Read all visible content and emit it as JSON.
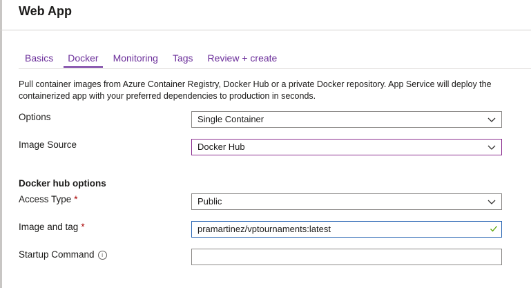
{
  "header": {
    "title": "Web App"
  },
  "tabs": [
    {
      "label": "Basics",
      "active": false
    },
    {
      "label": "Docker",
      "active": true
    },
    {
      "label": "Monitoring",
      "active": false
    },
    {
      "label": "Tags",
      "active": false
    },
    {
      "label": "Review + create",
      "active": false
    }
  ],
  "intro": {
    "text": "Pull container images from Azure Container Registry, Docker Hub or a private Docker repository. App Service will deploy the containerized app with your preferred dependencies to production in seconds."
  },
  "form": {
    "options": {
      "label": "Options",
      "value": "Single Container",
      "icon": "chevron-down-icon"
    },
    "image_source": {
      "label": "Image Source",
      "value": "Docker Hub",
      "icon": "chevron-down-icon"
    },
    "docker_hub_section": {
      "heading": "Docker hub options"
    },
    "access_type": {
      "label": "Access Type",
      "required_marker": "*",
      "value": "Public",
      "icon": "chevron-down-icon"
    },
    "image_and_tag": {
      "label": "Image and tag",
      "required_marker": "*",
      "value": "pramartinez/vptournaments:latest",
      "valid": true,
      "icon": "checkmark-icon"
    },
    "startup_command": {
      "label": "Startup Command",
      "info_icon": "info-icon",
      "info_glyph": "i",
      "value": ""
    }
  },
  "colors": {
    "accent": "#6b2e9a",
    "focus_border_select": "#8b2e8f",
    "focus_border_input": "#2e69b5",
    "required": "#a80000",
    "valid_check": "#57a300"
  }
}
